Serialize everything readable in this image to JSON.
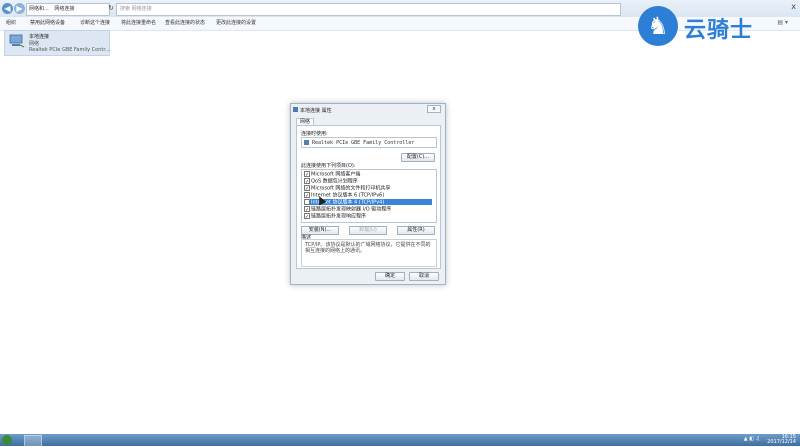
{
  "explorer": {
    "nav": {
      "back": "◀",
      "forward": "▶"
    },
    "breadcrumbs": [
      "网络和...",
      "网络连接"
    ],
    "search_placeholder": "搜索 网络连接",
    "commands": [
      "组织",
      "禁用此网络设备",
      "诊断这个连接",
      "将此连接重命名",
      "查看此连接的状态",
      "更改此连接的设置"
    ],
    "window_controls": "x"
  },
  "connection": {
    "name": "本地连接",
    "status": "网络",
    "device": "Realtek PCIe GBE Family Contr..."
  },
  "watermark": {
    "text": "云骑士",
    "icon": "knight-logo-icon"
  },
  "dialog": {
    "title": "本地连接 属性",
    "close_label": "x",
    "tab": "网络",
    "connect_using_label": "连接时使用:",
    "adapter_name": "Realtek PCIe GBE Family Controller",
    "configure_button": "配置(C)...",
    "items_label": "此连接使用下列项目(O):",
    "items": [
      {
        "label": "Microsoft 网络客户端",
        "checked": true,
        "selected": false
      },
      {
        "label": "QoS 数据包计划程序",
        "checked": true,
        "selected": false
      },
      {
        "label": "Microsoft 网络的文件和打印机共享",
        "checked": true,
        "selected": false
      },
      {
        "label": "Internet 协议版本 6 (TCP/IPv6)",
        "checked": true,
        "selected": false
      },
      {
        "label": "Internet 协议版本 4 (TCP/IPv4)",
        "checked": true,
        "selected": true
      },
      {
        "label": "链路层拓扑发现映射器 I/O 驱动程序",
        "checked": true,
        "selected": false
      },
      {
        "label": "链路层拓扑发现响应程序",
        "checked": true,
        "selected": false
      }
    ],
    "install_button": "安装(N)...",
    "uninstall_button": "卸载(U)",
    "properties_button": "属性(R)",
    "description_label": "描述",
    "description_text": "TCP/IP。该协议是默认的广域网络协议，它提供在不同的相互连接的网络上的通讯。",
    "ok_button": "确定",
    "cancel_button": "取消"
  },
  "taskbar": {
    "clock_time": "16:15",
    "clock_date": "2017/12/14"
  }
}
